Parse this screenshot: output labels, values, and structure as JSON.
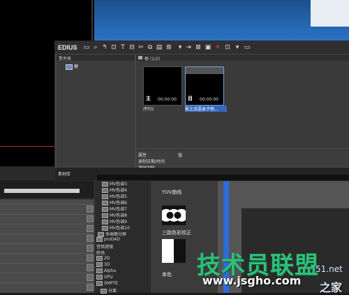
{
  "app": {
    "name": "EDIUS"
  },
  "folder_pane": {
    "header": "文件夹",
    "close_glyph": "×",
    "root_label": "根"
  },
  "clip_pane": {
    "header": "根 (1/2)"
  },
  "clips": [
    {
      "name": "序列1",
      "tag": "主",
      "timecode": "00:00:00",
      "selected": false
    },
    {
      "name": "影之流晶录子侧...",
      "tag": "目",
      "timecode": "00:00:00",
      "selected": true
    }
  ],
  "properties": {
    "col_property": "属性",
    "col_value": "值",
    "rows": [
      "录制日期/时间",
      "源时间码"
    ]
  },
  "bin_tab": {
    "label": "素材库"
  },
  "effects_list": [
    "MV色调3",
    "MV色调4",
    "MV色调5",
    "MV色调6",
    "MV色调7",
    "MV色调8",
    "MV色调9",
    "MV色调10",
    "多画面分屏",
    "proDAD",
    "音频滤镜",
    "转场",
    "2D",
    "3D",
    "Alpha",
    "GPU",
    "SMPTE",
    "分离"
  ],
  "effects_panel": {
    "items": [
      "YUV曲线",
      "三路色彩校正",
      "单色"
    ]
  },
  "watermark": {
    "brand": "技术员联盟",
    "url": "www.jsgho.com",
    "side": "51.net",
    "side2": "之家"
  }
}
